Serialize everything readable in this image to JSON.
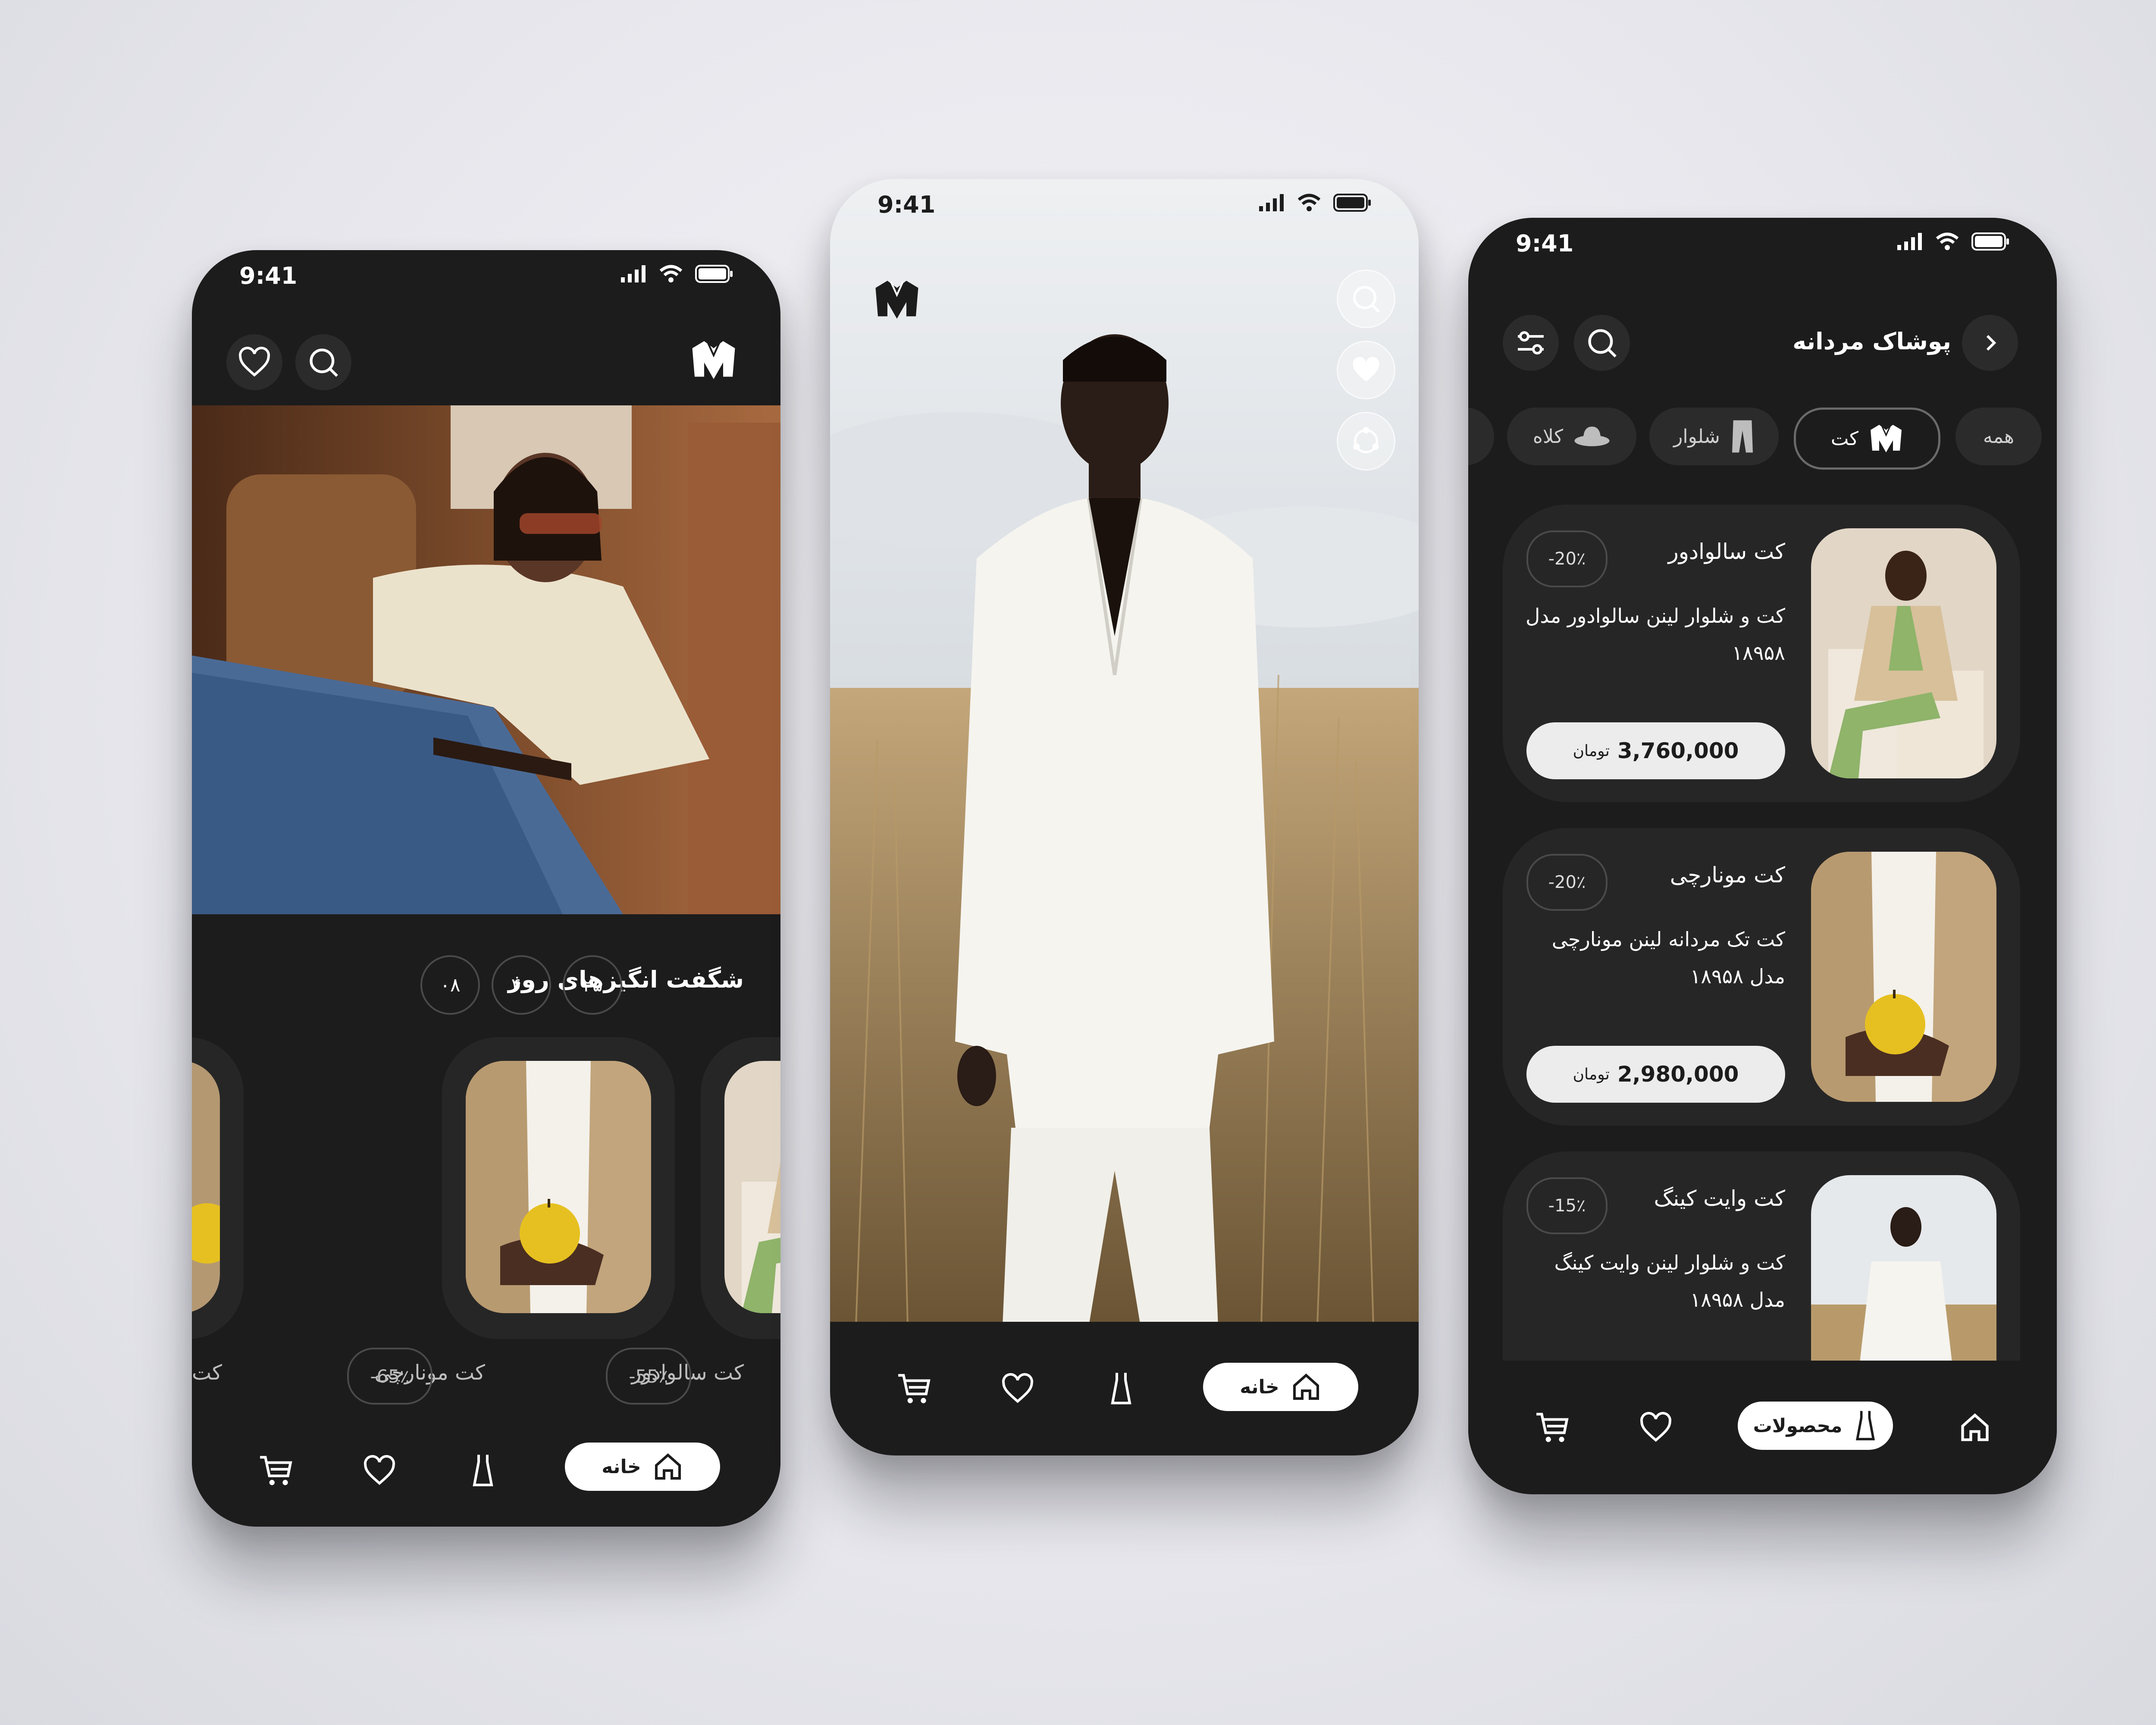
{
  "colors": {
    "dark": "#1c1c1c",
    "card": "#262626",
    "accent": "#ffffff",
    "muted": "#4a4a4a"
  },
  "left_phone": {
    "time": "9:41",
    "section_title": "شگفت انگیزهای روز",
    "countdown": [
      "۲۵",
      "۴۰",
      "۰۸"
    ],
    "products": [
      {
        "name": "کت سالوادور",
        "discount": "-55٪"
      },
      {
        "name": "کت مونارچی",
        "discount": "-65٪"
      },
      {
        "name": "کت"
      }
    ],
    "nav_home": "خانه"
  },
  "center_phone": {
    "time": "9:41",
    "nav_home": "خانه"
  },
  "right_phone": {
    "time": "9:41",
    "title": "پوشاک مردانه",
    "chips": [
      "همه",
      "کت",
      "شلوار",
      "کلاه"
    ],
    "products": [
      {
        "name": "کت سالوادور",
        "discount": "-20٪",
        "desc": "کت و شلوار لینن سالوادور مدل ۱۸۹۵۸",
        "price": "3,760,000",
        "currency": "تومان"
      },
      {
        "name": "کت مونارچی",
        "discount": "-20٪",
        "desc": "کت تک مردانه لینن مونارچی مدل ۱۸۹۵۸",
        "price": "2,980,000",
        "currency": "تومان"
      },
      {
        "name": "کت وایت کینگ",
        "discount": "-15٪",
        "desc": "کت و شلوار لینن وایت کینگ مدل ۱۸۹۵۸"
      }
    ],
    "nav_active": "محصولات"
  }
}
